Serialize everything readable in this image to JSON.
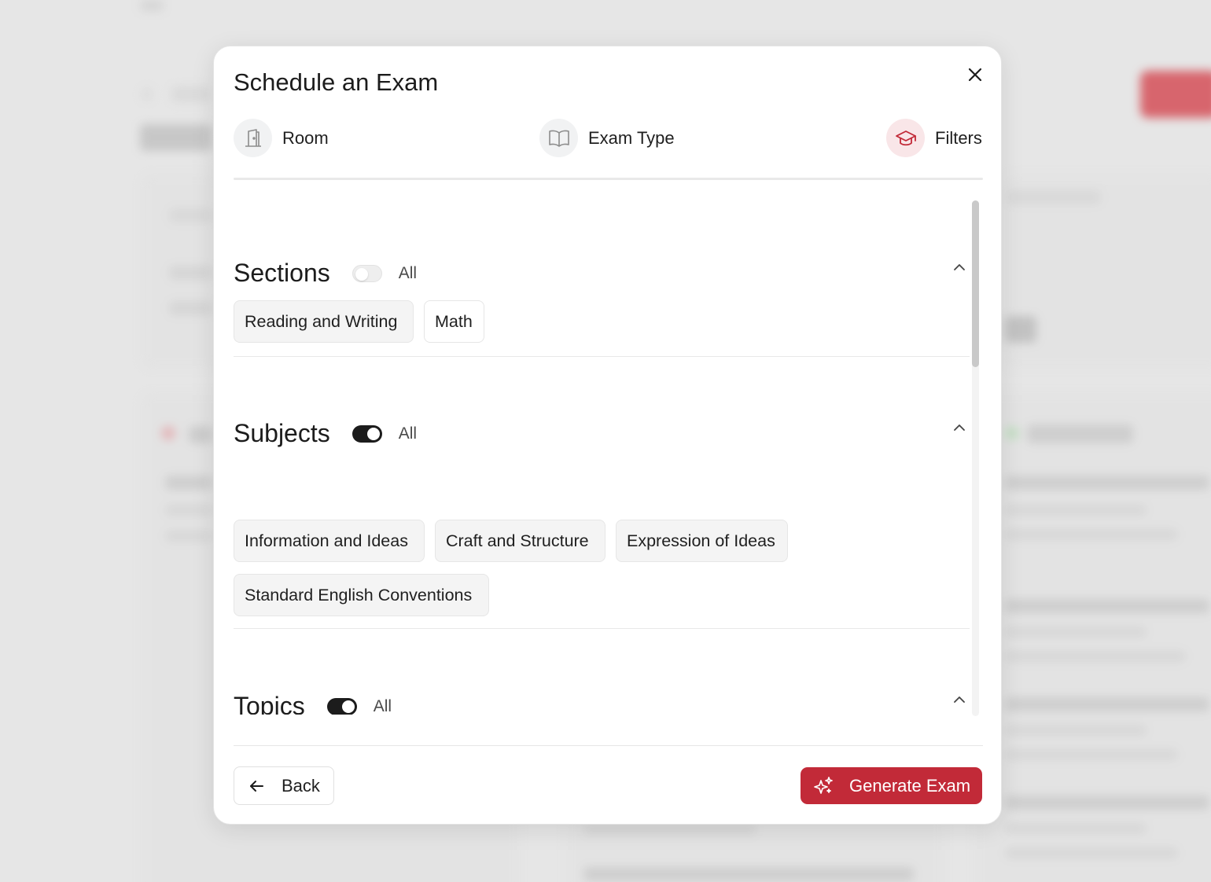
{
  "modal": {
    "title": "Schedule an Exam",
    "close_icon": "close-icon"
  },
  "steps": [
    {
      "label": "Room",
      "icon": "door-icon",
      "active": false
    },
    {
      "label": "Exam Type",
      "icon": "book-icon",
      "active": false
    },
    {
      "label": "Filters",
      "icon": "graduation-cap-icon",
      "active": true
    }
  ],
  "sections": {
    "title": "Sections",
    "all_label": "All",
    "all_on": false,
    "chips": [
      {
        "label": "Reading and Writing",
        "selected": true
      },
      {
        "label": "Math",
        "selected": false
      }
    ]
  },
  "subjects": {
    "title": "Subjects",
    "all_label": "All",
    "all_on": true,
    "chips": [
      {
        "label": "Information and Ideas",
        "selected": true
      },
      {
        "label": "Craft and Structure",
        "selected": true
      },
      {
        "label": "Expression of Ideas",
        "selected": true
      },
      {
        "label": "Standard English Conventions",
        "selected": true
      }
    ]
  },
  "topics": {
    "title": "Topics",
    "all_label": "All",
    "all_on": true
  },
  "footer": {
    "back_label": "Back",
    "generate_label": "Generate Exam"
  },
  "colors": {
    "accent": "#c22a38",
    "active_step_bg": "#f9e6e8",
    "toggle_on": "#1c1c1c"
  }
}
